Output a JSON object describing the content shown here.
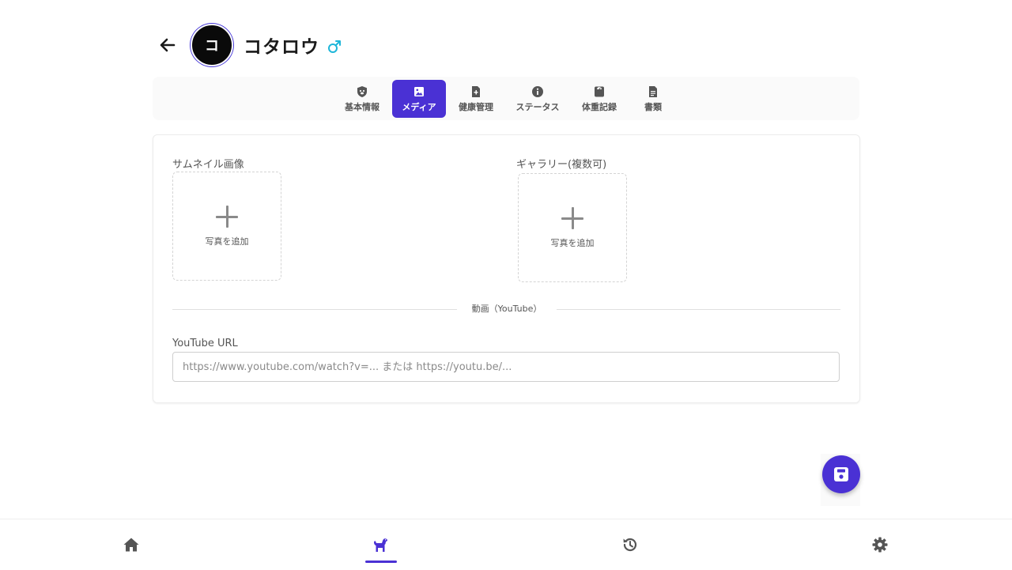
{
  "header": {
    "avatar_initial": "コ",
    "pet_name": "コタロウ",
    "gender_symbol": "♂",
    "gender_color": "#1eb6d9"
  },
  "tabs": [
    {
      "label": "基本情報",
      "icon": "shield-paw-icon",
      "active": false
    },
    {
      "label": "メディア",
      "icon": "image-icon",
      "active": true
    },
    {
      "label": "健康管理",
      "icon": "file-medical-icon",
      "active": false
    },
    {
      "label": "ステータス",
      "icon": "info-icon",
      "active": false
    },
    {
      "label": "体重記録",
      "icon": "weight-icon",
      "active": false
    },
    {
      "label": "書類",
      "icon": "document-icon",
      "active": false
    }
  ],
  "media": {
    "thumbnail_label": "サムネイル画像",
    "thumbnail_add_label": "写真を追加",
    "gallery_label": "ギャラリー(複数可)",
    "gallery_add_label": "写真を追加",
    "video_section_label": "動画（YouTube）",
    "youtube_url_label": "YouTube URL",
    "youtube_url_value": "",
    "youtube_url_placeholder": "https://www.youtube.com/watch?v=... または https://youtu.be/..."
  },
  "bottom_nav": [
    {
      "icon": "home-icon",
      "active": false
    },
    {
      "icon": "dog-icon",
      "active": true
    },
    {
      "icon": "history-icon",
      "active": false
    },
    {
      "icon": "gear-icon",
      "active": false
    }
  ],
  "colors": {
    "accent": "#4a31d4",
    "text": "#1f1f1f",
    "muted": "#555555"
  }
}
